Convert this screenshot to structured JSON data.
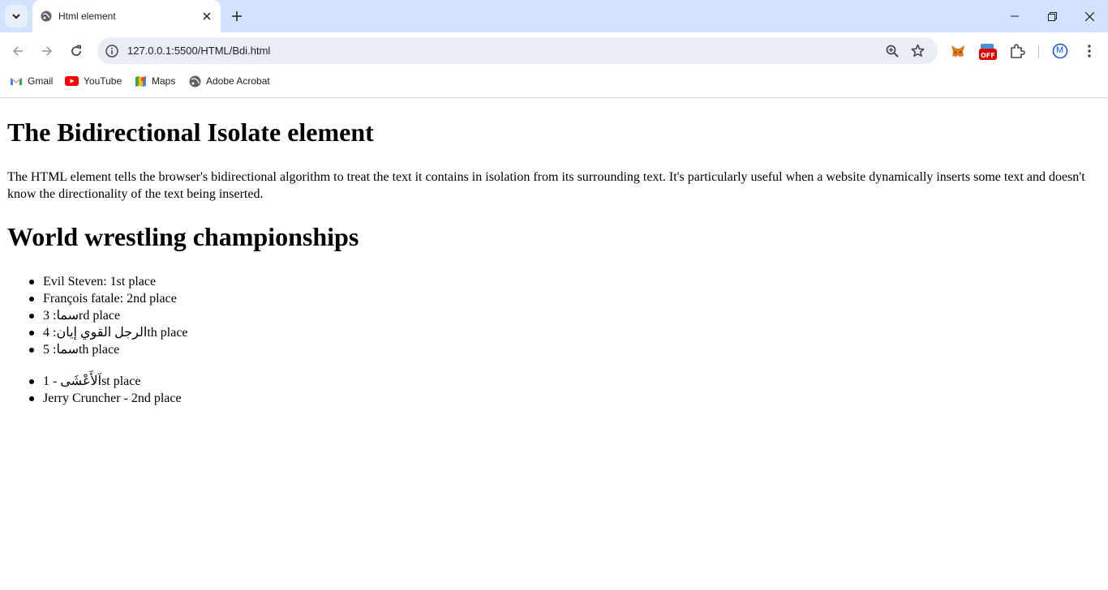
{
  "browser": {
    "tab_title": "Html element",
    "url": "127.0.0.1:5500/HTML/Bdi.html",
    "bookmarks": [
      {
        "label": "Gmail",
        "icon": "gmail-icon"
      },
      {
        "label": "YouTube",
        "icon": "youtube-icon"
      },
      {
        "label": "Maps",
        "icon": "maps-icon"
      },
      {
        "label": "Adobe Acrobat",
        "icon": "globe-icon"
      }
    ],
    "extension_badge": "OFF",
    "profile_initial": "M"
  },
  "page": {
    "heading1": "The Bidirectional Isolate element",
    "paragraph": "The HTML element tells the browser's bidirectional algorithm to treat the text it contains in isolation from its surrounding text. It's particularly useful when a website dynamically inserts some text and doesn't know the directionality of the text being inserted.",
    "heading2": "World wrestling championships",
    "list1": [
      "Evil Steven: 1st place",
      "François fatale: 2nd place",
      "3 :سما‬rd place",
      "الرجل القوي إيان: 4th place",
      "سما: 5th place"
    ],
    "list2": [
      "اَلأَعْشَى - 1st place",
      "Jerry Cruncher - 2nd place"
    ]
  },
  "colors": {
    "tabstrip_bg": "#d3e3fd",
    "omnibox_bg": "#e9eef6",
    "accent_blue": "#0b57d0"
  }
}
